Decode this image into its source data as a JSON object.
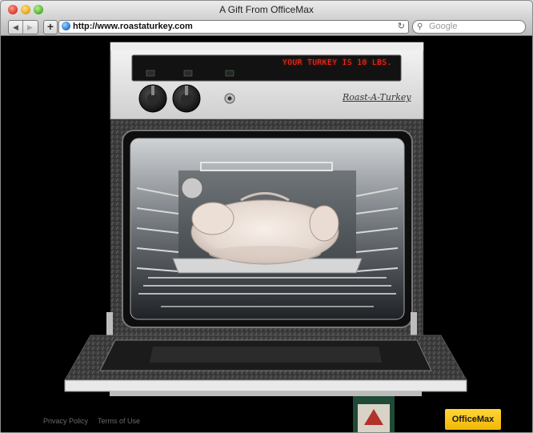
{
  "window": {
    "title": "A Gift From OfficeMax"
  },
  "toolbar": {
    "back_icon": "back-arrow-icon",
    "forward_icon": "forward-arrow-icon",
    "add_label": "+",
    "url": "http://www.roastaturkey.com",
    "reload_icon": "reload-icon",
    "search_placeholder": "Google"
  },
  "oven": {
    "display_text": "YOUR TURKEY IS 10 LBS.",
    "brand_label": "Roast-A-Turkey",
    "colors": {
      "display_text": "#ff2a1a",
      "panel": "#e6e6e6",
      "speckle_body": "#3a3a3a"
    }
  },
  "footer": {
    "privacy_label": "Privacy Policy",
    "terms_label": "Terms of Use",
    "logo_label": "OfficeMax",
    "logo_color": "#f2b705"
  }
}
